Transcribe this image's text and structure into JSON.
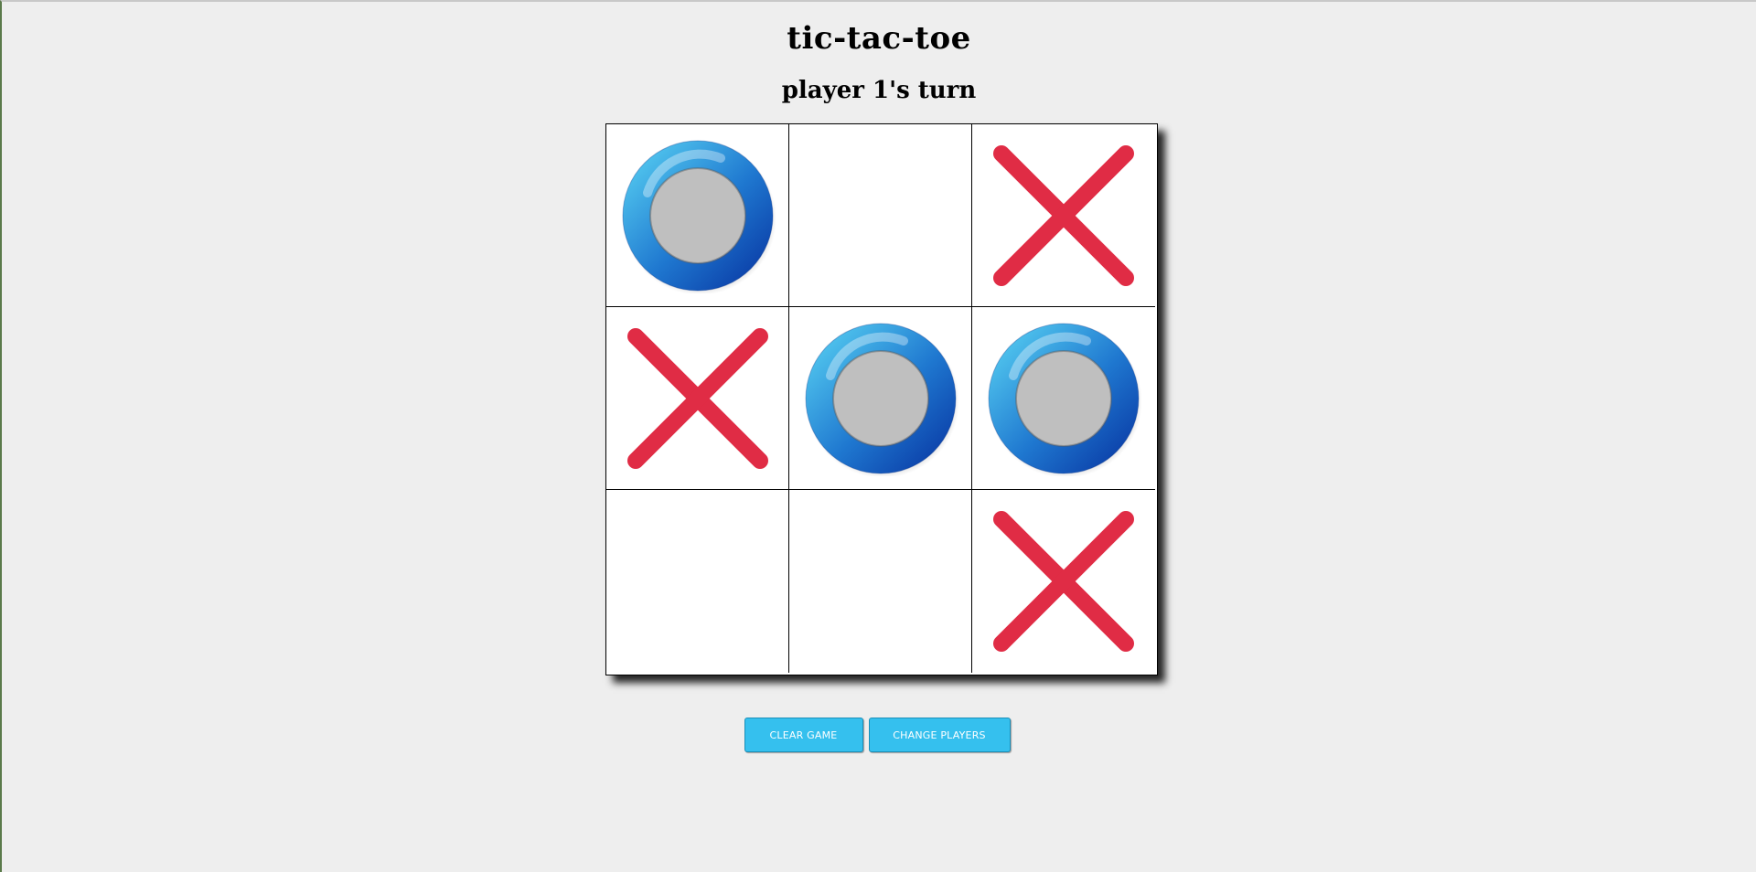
{
  "game": {
    "title": "tic-tac-toe",
    "status": "player 1's turn"
  },
  "board": {
    "cells": [
      "O",
      "",
      "X",
      "X",
      "O",
      "O",
      "",
      "",
      "X"
    ]
  },
  "buttons": {
    "clear_label": "CLEAR GAME",
    "change_players_label": "CHANGE PLAYERS"
  },
  "colors": {
    "x_mark": "#e02c45",
    "o_ring_light": "#52c8ef",
    "o_ring_dark": "#0b3ea8",
    "button": "#35c0ee",
    "background": "#eeeeee"
  },
  "icons": {
    "x": "x-mark-icon",
    "o": "o-mark-icon"
  }
}
